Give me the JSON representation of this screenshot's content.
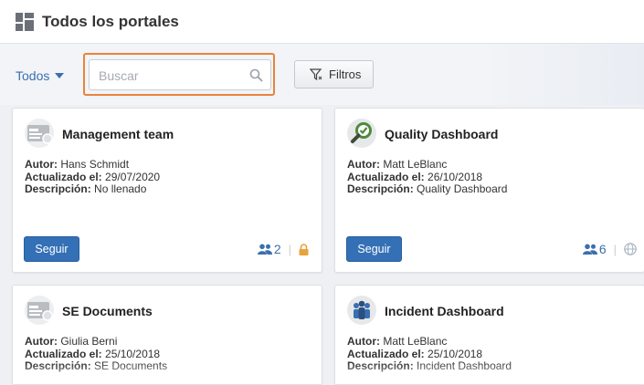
{
  "header": {
    "title": "Todos los portales",
    "icon": "portals-grid-icon"
  },
  "toolbar": {
    "scope_label": "Todos",
    "search": {
      "placeholder": "Buscar",
      "value": ""
    },
    "filter_label": "Filtros"
  },
  "labels": {
    "author": "Autor:",
    "updated": "Actualizado el:",
    "description": "Descripción:",
    "follow": "Seguir"
  },
  "cards": [
    {
      "title": "Management team",
      "icon": "generic-portal-icon",
      "author": "Hans Schmidt",
      "updated": "29/07/2020",
      "description": "No llenado",
      "members": "2",
      "visibility_icon": "lock-icon"
    },
    {
      "title": "Quality Dashboard",
      "icon": "quality-magnifier-icon",
      "author": "Matt LeBlanc",
      "updated": "26/10/2018",
      "description": "Quality Dashboard",
      "members": "6",
      "visibility_icon": "globe-icon"
    },
    {
      "title": "SE Documents",
      "icon": "generic-portal-icon",
      "author": "Giulia Berni",
      "updated": "25/10/2018",
      "description": "SE Documents"
    },
    {
      "title": "Incident Dashboard",
      "icon": "incident-people-icon",
      "author": "Matt LeBlanc",
      "updated": "25/10/2018",
      "description": "Incident Dashboard"
    }
  ],
  "colors": {
    "accent": "#3470b6",
    "highlight": "#e8843b",
    "lock": "#e8a33d",
    "link": "#3a6fb0"
  }
}
